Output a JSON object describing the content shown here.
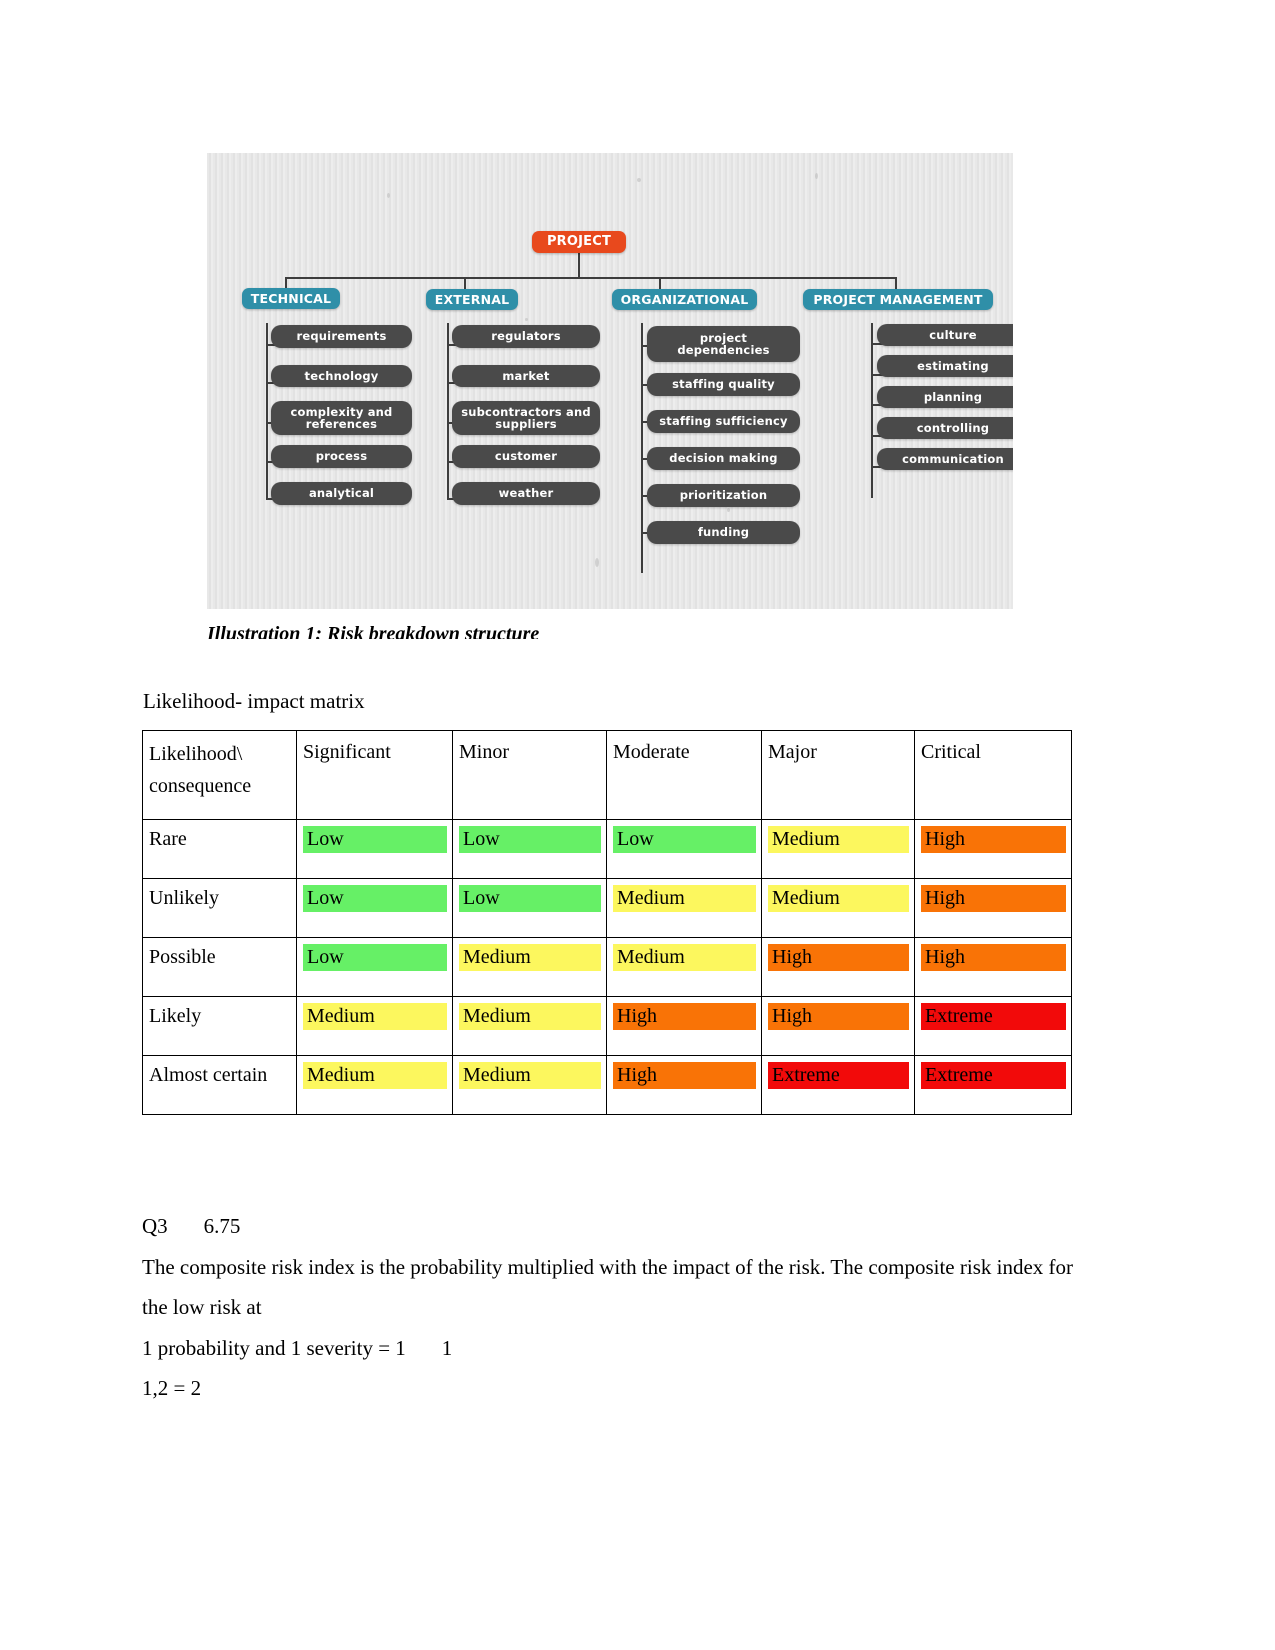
{
  "figure": {
    "caption": "Illustration 1: Risk breakdown structure",
    "root": {
      "label": "PROJECT"
    },
    "categories": [
      {
        "label": "TECHNICAL",
        "items": [
          "requirements",
          "technology",
          "complexity and references",
          "process",
          "analytical"
        ]
      },
      {
        "label": "EXTERNAL",
        "items": [
          "regulators",
          "market",
          "subcontractors and suppliers",
          "customer",
          "weather"
        ]
      },
      {
        "label": "ORGANIZATIONAL",
        "items": [
          "project dependencies",
          "staffing quality",
          "staffing sufficiency",
          "decision making",
          "prioritization",
          "funding"
        ]
      },
      {
        "label": "PROJECT MANAGEMENT",
        "items": [
          "culture",
          "estimating",
          "planning",
          "controlling",
          "communication"
        ]
      }
    ],
    "colors": {
      "root": "#e8491d",
      "category": "#2f8fa8",
      "leaf": "#4a4a4a",
      "background": "#e8e8e8"
    }
  },
  "matrix": {
    "heading": "Likelihood- impact matrix",
    "corner_line1": "Likelihood\\",
    "corner_line2": "consequence",
    "columns": [
      "Significant",
      "Minor",
      "Moderate",
      "Major",
      "Critical"
    ],
    "rows": [
      {
        "likelihood": "Rare",
        "cells": [
          {
            "label": "Low",
            "level": "low"
          },
          {
            "label": "Low",
            "level": "low"
          },
          {
            "label": "Low",
            "level": "low"
          },
          {
            "label": "Medium",
            "level": "medium"
          },
          {
            "label": "High",
            "level": "high"
          }
        ]
      },
      {
        "likelihood": "Unlikely",
        "cells": [
          {
            "label": "Low",
            "level": "low"
          },
          {
            "label": "Low",
            "level": "low"
          },
          {
            "label": "Medium",
            "level": "medium"
          },
          {
            "label": "Medium",
            "level": "medium"
          },
          {
            "label": "High",
            "level": "high"
          }
        ]
      },
      {
        "likelihood": "Possible",
        "cells": [
          {
            "label": "Low",
            "level": "low"
          },
          {
            "label": "Medium",
            "level": "medium"
          },
          {
            "label": "Medium",
            "level": "medium"
          },
          {
            "label": "High",
            "level": "high"
          },
          {
            "label": "High",
            "level": "high"
          }
        ]
      },
      {
        "likelihood": "Likely",
        "cells": [
          {
            "label": "Medium",
            "level": "medium"
          },
          {
            "label": "Medium",
            "level": "medium"
          },
          {
            "label": "High",
            "level": "high"
          },
          {
            "label": "High",
            "level": "high"
          },
          {
            "label": "Extreme",
            "level": "extreme"
          }
        ]
      },
      {
        "likelihood": "Almost certain",
        "cells": [
          {
            "label": "Medium",
            "level": "medium"
          },
          {
            "label": "Medium",
            "level": "medium"
          },
          {
            "label": "High",
            "level": "high"
          },
          {
            "label": "Extreme",
            "level": "extreme"
          },
          {
            "label": "Extreme",
            "level": "extreme"
          }
        ]
      }
    ],
    "legend_colors": {
      "low": "#66f066",
      "medium": "#fcf75e",
      "high": "#f97306",
      "extreme": "#f20a0a"
    }
  },
  "answer": {
    "q3_label": "Q3",
    "q3_score": "6.75",
    "paragraph": "The composite risk index is the probability multiplied with the impact of the risk. The composite risk index for the low risk at",
    "line1_a": "1 probability and 1 severity = 1",
    "line1_b": "1",
    "line2": "1,2 = 2"
  }
}
